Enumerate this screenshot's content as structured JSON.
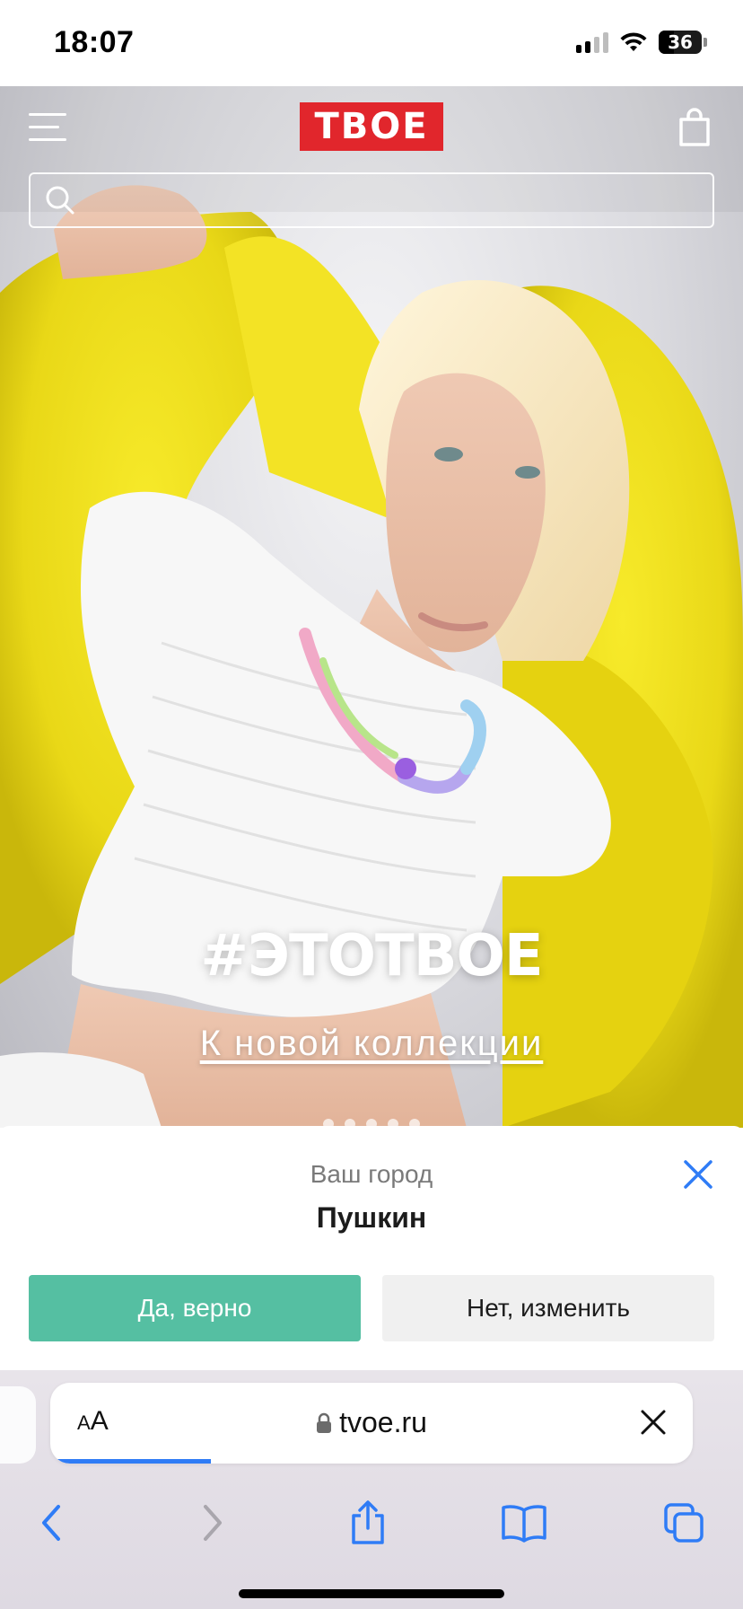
{
  "status_bar": {
    "time": "18:07",
    "battery": "36",
    "battery_fraction": 0.36
  },
  "site": {
    "logo_text": "ТВОЕ",
    "brand_color": "#e1262c",
    "header_icons": [
      "menu-icon",
      "shopping-bag-icon"
    ],
    "search": {
      "value": "",
      "placeholder": "",
      "icon": "search-icon"
    }
  },
  "hero": {
    "title": "#ЭТОТВОЕ",
    "link_label": "К новой коллекции",
    "slides": 5
  },
  "city_popup": {
    "label": "Ваш город",
    "city": "Пушкин",
    "confirm_label": "Да, верно",
    "change_label": "Нет, изменить",
    "confirm_color": "#55bfa2",
    "close_icon": "close-icon"
  },
  "browser": {
    "text_size_label_small": "A",
    "text_size_label_large": "A",
    "url": "tvoe.ru",
    "load_progress": 0.25,
    "accent_color": "#2f7cf6",
    "toolbar_icons": [
      "back-icon",
      "forward-icon",
      "share-icon",
      "bookmarks-icon",
      "tabs-icon"
    ]
  }
}
